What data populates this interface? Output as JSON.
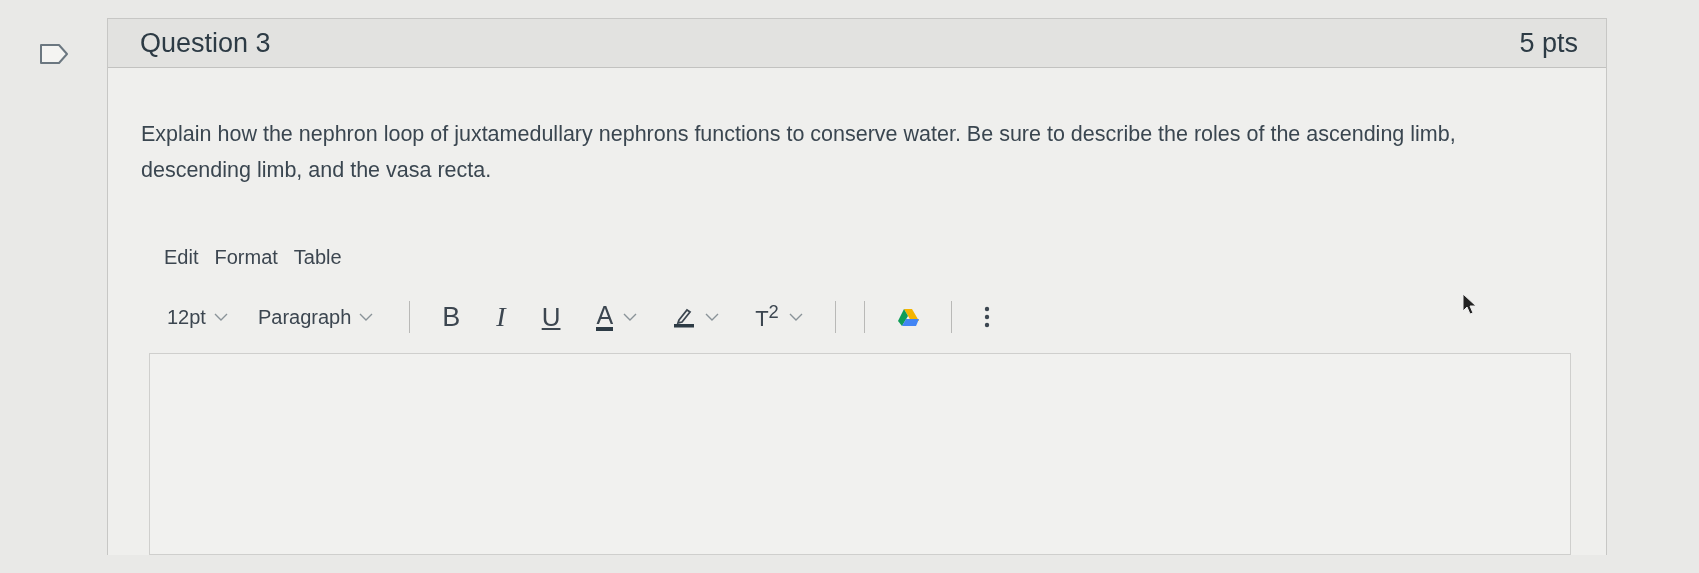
{
  "question": {
    "title": "Question 3",
    "points": "5 pts",
    "text": "Explain how the nephron loop of juxtamedullary nephrons functions to conserve water.  Be sure to describe the roles of the ascending limb, descending limb, and the vasa recta."
  },
  "editor": {
    "menu": [
      "Edit",
      "Format",
      "Table"
    ],
    "toolbar": [
      {
        "kind": "select",
        "label": "12pt"
      },
      {
        "kind": "select",
        "label": "Paragraph"
      },
      {
        "kind": "divider"
      },
      {
        "kind": "bold",
        "label": "B"
      },
      {
        "kind": "italic",
        "label": "I"
      },
      {
        "kind": "underline",
        "label": "U"
      },
      {
        "kind": "color",
        "label": "A"
      },
      {
        "kind": "highlight"
      },
      {
        "kind": "superscript",
        "label": "T$^{2}$"
      },
      {
        "kind": "divider"
      },
      {
        "kind": "divider"
      },
      {
        "kind": "drive"
      },
      {
        "kind": "divider"
      },
      {
        "kind": "more"
      }
    ]
  }
}
